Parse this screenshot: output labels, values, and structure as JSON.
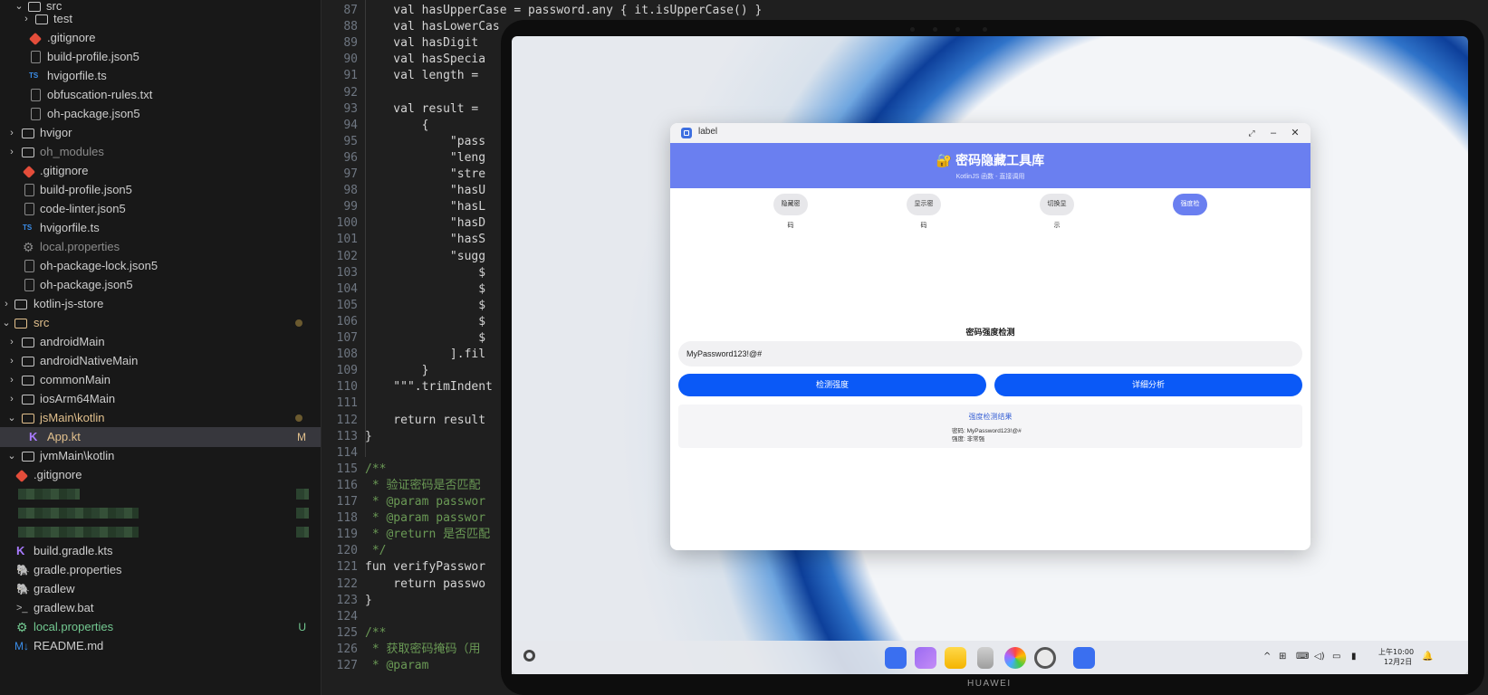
{
  "explorer": {
    "rows": [
      {
        "label": "src",
        "badge": ""
      },
      {
        "label": "test",
        "badge": ""
      },
      {
        "label": ".gitignore",
        "badge": ""
      },
      {
        "label": "build-profile.json5",
        "badge": ""
      },
      {
        "label": "hvigorfile.ts",
        "badge": ""
      },
      {
        "label": "obfuscation-rules.txt",
        "badge": ""
      },
      {
        "label": "oh-package.json5",
        "badge": ""
      },
      {
        "label": "hvigor",
        "badge": ""
      },
      {
        "label": "oh_modules",
        "badge": ""
      },
      {
        "label": ".gitignore",
        "badge": ""
      },
      {
        "label": "build-profile.json5",
        "badge": ""
      },
      {
        "label": "code-linter.json5",
        "badge": ""
      },
      {
        "label": "hvigorfile.ts",
        "badge": ""
      },
      {
        "label": "local.properties",
        "badge": ""
      },
      {
        "label": "oh-package-lock.json5",
        "badge": ""
      },
      {
        "label": "oh-package.json5",
        "badge": ""
      },
      {
        "label": "kotlin-js-store",
        "badge": ""
      },
      {
        "label": "src",
        "badge": ""
      },
      {
        "label": "androidMain",
        "badge": ""
      },
      {
        "label": "androidNativeMain",
        "badge": ""
      },
      {
        "label": "commonMain",
        "badge": ""
      },
      {
        "label": "iosArm64Main",
        "badge": ""
      },
      {
        "label": "jsMain\\kotlin",
        "badge": ""
      },
      {
        "label": "App.kt",
        "badge": "M"
      },
      {
        "label": "jvmMain\\kotlin",
        "badge": ""
      },
      {
        "label": ".gitignore",
        "badge": ""
      },
      {
        "label": "build.gradle.kts",
        "badge": ""
      },
      {
        "label": "gradle.properties",
        "badge": ""
      },
      {
        "label": "gradlew",
        "badge": ""
      },
      {
        "label": "gradlew.bat",
        "badge": ""
      },
      {
        "label": "local.properties",
        "badge": "U"
      },
      {
        "label": "README.md",
        "badge": ""
      }
    ]
  },
  "editor": {
    "lines": [
      {
        "n": "87",
        "code": "    val hasUpperCase = password.any { it.isUpperCase() }"
      },
      {
        "n": "88",
        "code": "    val hasLowerCas"
      },
      {
        "n": "89",
        "code": "    val hasDigit"
      },
      {
        "n": "90",
        "code": "    val hasSpecia"
      },
      {
        "n": "91",
        "code": "    val length ="
      },
      {
        "n": "92",
        "code": ""
      },
      {
        "n": "93",
        "code": "    val result ="
      },
      {
        "n": "94",
        "code": "        {"
      },
      {
        "n": "95",
        "code": "            \"pass"
      },
      {
        "n": "96",
        "code": "            \"leng"
      },
      {
        "n": "97",
        "code": "            \"stre"
      },
      {
        "n": "98",
        "code": "            \"hasU"
      },
      {
        "n": "99",
        "code": "            \"hasL"
      },
      {
        "n": "100",
        "code": "            \"hasD"
      },
      {
        "n": "101",
        "code": "            \"hasS"
      },
      {
        "n": "102",
        "code": "            \"sugg"
      },
      {
        "n": "103",
        "code": "                $"
      },
      {
        "n": "104",
        "code": "                $"
      },
      {
        "n": "105",
        "code": "                $"
      },
      {
        "n": "106",
        "code": "                $"
      },
      {
        "n": "107",
        "code": "                $"
      },
      {
        "n": "108",
        "code": "            ].fil"
      },
      {
        "n": "109",
        "code": "        }"
      },
      {
        "n": "110",
        "code": "    \"\"\".trimIndent"
      },
      {
        "n": "111",
        "code": ""
      },
      {
        "n": "112",
        "code": "    return result"
      },
      {
        "n": "113",
        "code": "}"
      },
      {
        "n": "114",
        "code": ""
      },
      {
        "n": "115",
        "code": "/**"
      },
      {
        "n": "116",
        "code": " * 验证密码是否匹配"
      },
      {
        "n": "117",
        "code": " * @param passwor"
      },
      {
        "n": "118",
        "code": " * @param passwor"
      },
      {
        "n": "119",
        "code": " * @return 是否匹配"
      },
      {
        "n": "120",
        "code": " */"
      },
      {
        "n": "121",
        "code": "fun verifyPasswor"
      },
      {
        "n": "122",
        "code": "    return passwo"
      },
      {
        "n": "123",
        "code": "}"
      },
      {
        "n": "124",
        "code": ""
      },
      {
        "n": "125",
        "code": "/**"
      },
      {
        "n": "126",
        "code": " * 获取密码掩码（用"
      },
      {
        "n": "127",
        "code": " * @param             原始密码"
      }
    ]
  },
  "device": {
    "brand": "HUAWEI"
  },
  "app_window": {
    "title": "label",
    "header_title": "🔐 密码隐藏工具库",
    "header_subtitle": "KotlinJS 函数 - 直接调用",
    "tabs": [
      "隐藏密码",
      "显示密码",
      "切换显示",
      "强度检测"
    ],
    "active_tab": "强度检测",
    "section_title": "密码强度检测",
    "password_value": "MyPassword123!@#",
    "buttons": {
      "check": "检测强度",
      "analyze": "详细分析"
    },
    "result": {
      "title": "强度检测结果",
      "password_line": "密码: MyPassword123!@#",
      "strength_line": "强度: 非常强"
    },
    "controls": {
      "restore": "⤢",
      "minimize": "–",
      "close": "✕"
    }
  },
  "taskbar": {
    "apps": [
      "launcher-app",
      "multitask-app",
      "notes-app",
      "trash-app",
      "gallery-app",
      "settings-app",
      "label-app"
    ],
    "tray_icons": [
      "chevron-up-icon",
      "input-method-icon",
      "keyboard-icon",
      "volume-icon",
      "display-icon",
      "battery-icon"
    ],
    "time": "上午10:00",
    "date": "12月2日"
  },
  "colors": {
    "accent": "#6a7ff0",
    "primary_button": "#0a59f7",
    "modified": "#e2c08d",
    "untracked": "#73c991"
  }
}
